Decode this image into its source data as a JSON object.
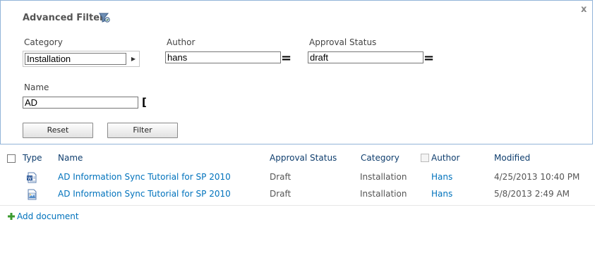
{
  "filter_panel": {
    "title": "Advanced Filter",
    "close_symbol": "x",
    "category": {
      "label": "Category",
      "value": "Installation"
    },
    "author": {
      "label": "Author",
      "value": "hans",
      "operator": "="
    },
    "approval_status": {
      "label": "Approval Status",
      "value": "draft",
      "operator": "="
    },
    "name": {
      "label": "Name",
      "value": "AD",
      "operator": "["
    },
    "reset_label": "Reset",
    "filter_label": "Filter"
  },
  "table": {
    "headers": {
      "type": "Type",
      "name": "Name",
      "approval_status": "Approval Status",
      "category": "Category",
      "author": "Author",
      "modified": "Modified"
    },
    "rows": [
      {
        "icon": "word-document-icon",
        "name": "AD Information Sync Tutorial for SP 2010",
        "approval_status": "Draft",
        "category": "Installation",
        "author": "Hans",
        "modified": "4/25/2013 10:40 PM"
      },
      {
        "icon": "image-document-icon",
        "name": "AD Information Sync Tutorial for SP 2010",
        "approval_status": "Draft",
        "category": "Installation",
        "author": "Hans",
        "modified": "5/8/2013 2:49 AM"
      }
    ]
  },
  "add_document_label": "Add document",
  "colors": {
    "link": "#0072bc",
    "header_text": "#0f3e6e",
    "panel_border": "#92b4d8",
    "add_icon": "#3a9a2e"
  }
}
